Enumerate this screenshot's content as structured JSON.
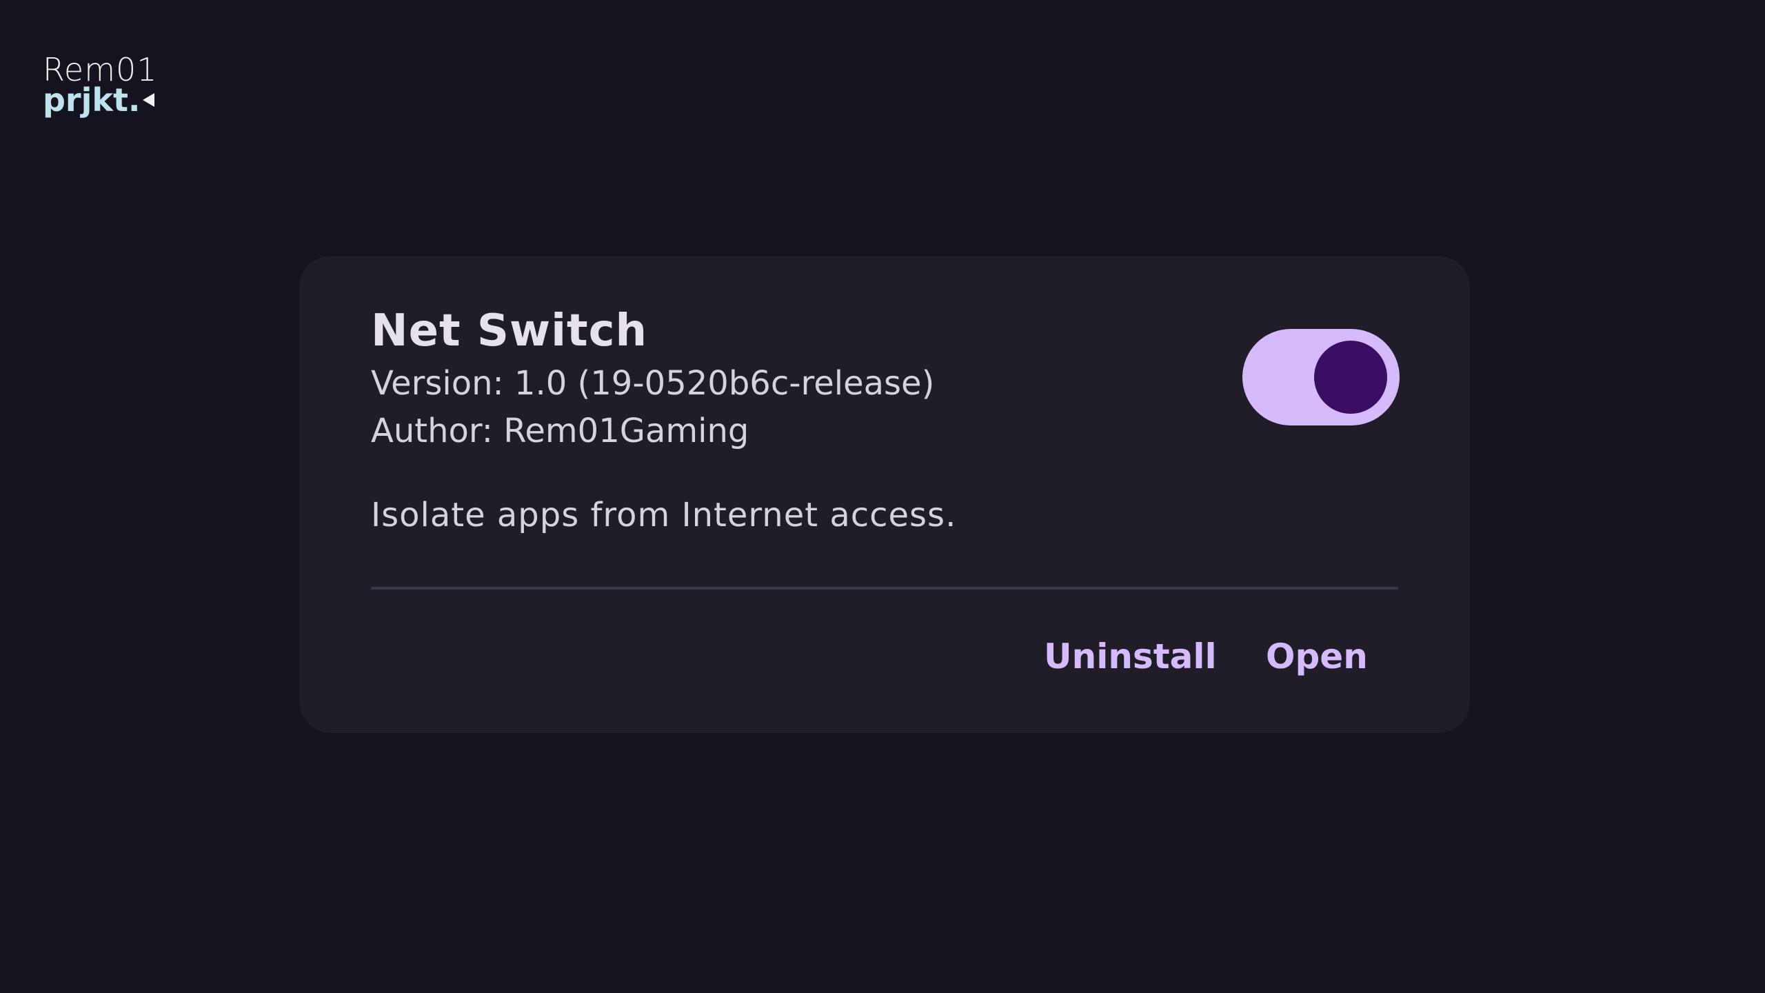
{
  "watermark": {
    "line1": "Rem01",
    "line2": "prjkt."
  },
  "module": {
    "name": "Net Switch",
    "version": "Version: 1.0 (19-0520b6c-release)",
    "author": "Author: Rem01Gaming",
    "description": "Isolate apps from Internet access.",
    "enabled": true
  },
  "actions": {
    "uninstall_label": "Uninstall",
    "open_label": "Open"
  },
  "colors": {
    "background": "#15131d",
    "card": "#201d29",
    "accent": "#d5bbfb",
    "toggle_thumb": "#3b0d64"
  }
}
